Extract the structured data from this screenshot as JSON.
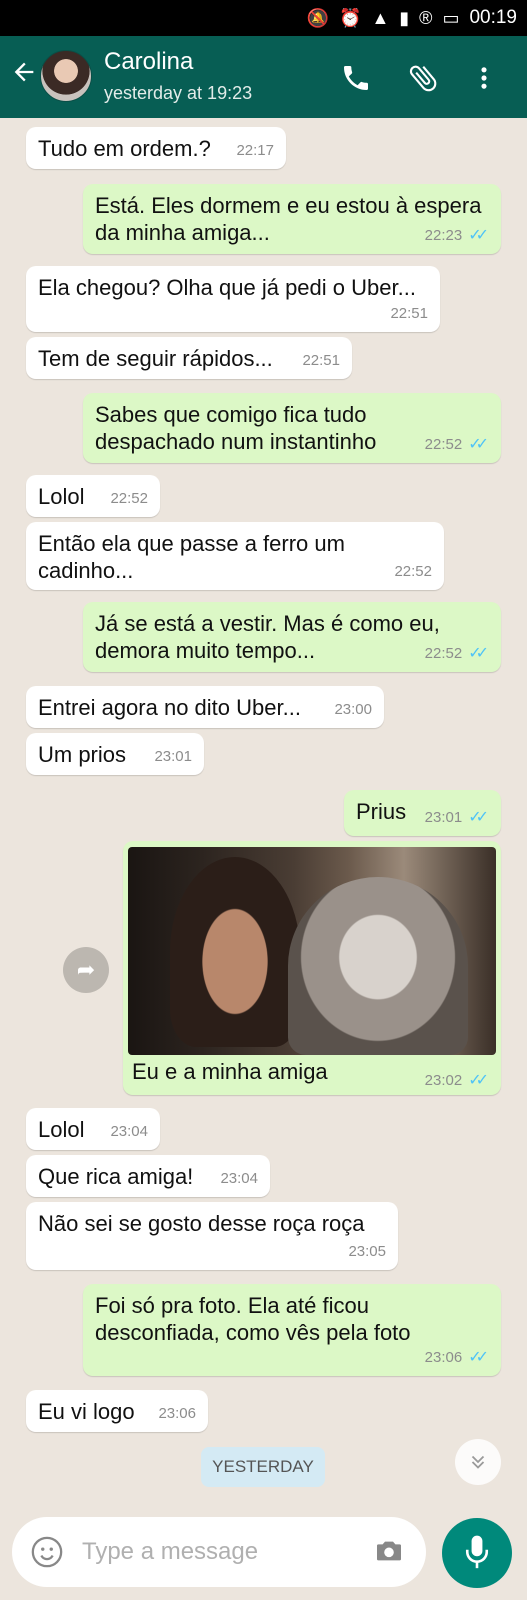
{
  "statusbar": {
    "time": "00:19"
  },
  "header": {
    "contact_name": "Carolina",
    "contact_status": "yesterday at 19:23"
  },
  "messages": [
    {
      "dir": "in",
      "text": "Tudo em ordem.?",
      "time": "22:17"
    },
    {
      "dir": "out",
      "text": "Está. Eles dormem e eu estou à espera da minha amiga...",
      "time": "22:23"
    },
    {
      "dir": "in",
      "text": "Ela chegou? Olha que já pedi o Uber...",
      "time": "22:51"
    },
    {
      "dir": "in",
      "text": "Tem de seguir rápidos...",
      "time": "22:51"
    },
    {
      "dir": "out",
      "text": "Sabes que comigo fica tudo despachado num instantinho",
      "time": "22:52"
    },
    {
      "dir": "in",
      "text": "Lolol",
      "time": "22:52"
    },
    {
      "dir": "in",
      "text": "Então ela que passe a ferro um cadinho...",
      "time": "22:52"
    },
    {
      "dir": "out",
      "text": "Já se está a vestir. Mas é como eu, demora muito tempo...",
      "time": "22:52"
    },
    {
      "dir": "in",
      "text": "Entrei agora no dito Uber...",
      "time": "23:00"
    },
    {
      "dir": "in",
      "text": "Um prios",
      "time": "23:01"
    },
    {
      "dir": "out",
      "text": "Prius",
      "time": "23:01"
    },
    {
      "dir": "out",
      "type": "photo",
      "caption": "Eu e a minha amiga",
      "time": "23:02"
    },
    {
      "dir": "in",
      "text": "Lolol",
      "time": "23:04"
    },
    {
      "dir": "in",
      "text": "Que rica amiga!",
      "time": "23:04"
    },
    {
      "dir": "in",
      "text": "Não sei se gosto desse roça roça",
      "time": "23:05"
    },
    {
      "dir": "out",
      "text": "Foi só pra foto. Ela até ficou desconfiada, como vês pela foto",
      "time": "23:06"
    },
    {
      "dir": "in",
      "text": "Eu vi logo",
      "time": "23:06"
    }
  ],
  "date_chip": "YESTERDAY",
  "composer": {
    "placeholder": "Type a message"
  },
  "colors": {
    "header": "#075e54",
    "outgoing": "#dcf8c6",
    "incoming": "#ffffff",
    "mic": "#00897b",
    "read_ticks": "#4fc3f7"
  }
}
